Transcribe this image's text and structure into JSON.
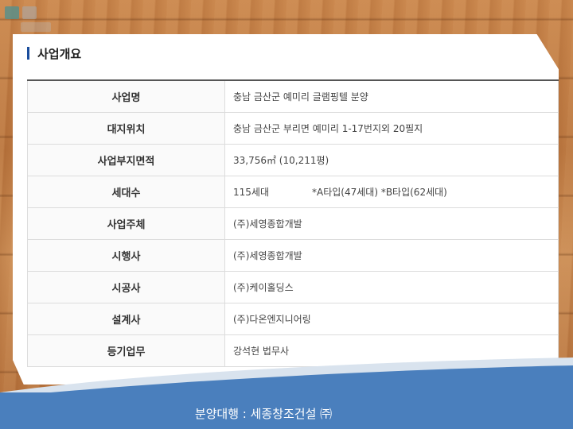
{
  "section_title": "사업개요",
  "rows": [
    {
      "label": "사업명",
      "value": "충남 금산군 예미리 글램핑텔 분양"
    },
    {
      "label": "대지위치",
      "value": "충남 금산군 부리면 예미리 1-17번지외 20필지"
    },
    {
      "label": "사업부지면적",
      "value": "33,756㎡ (10,211평)"
    },
    {
      "label": "세대수",
      "value": "115세대",
      "value2": "*A타입(47세대) *B타입(62세대)"
    },
    {
      "label": "사업주체",
      "value": "(주)세영종합개발"
    },
    {
      "label": "시행사",
      "value": "(주)세영종합개발"
    },
    {
      "label": "시공사",
      "value": "(주)케이홀딩스"
    },
    {
      "label": "설계사",
      "value": "(주)다온엔지니어링"
    },
    {
      "label": "등기업무",
      "value": "강석현 법무사"
    }
  ],
  "footer": "분양대행 : 세종창조건설 ㈜",
  "colors": {
    "accent": "#1a4d9c",
    "footer_band": "#4a7fbd",
    "wood": "#c8844a"
  }
}
